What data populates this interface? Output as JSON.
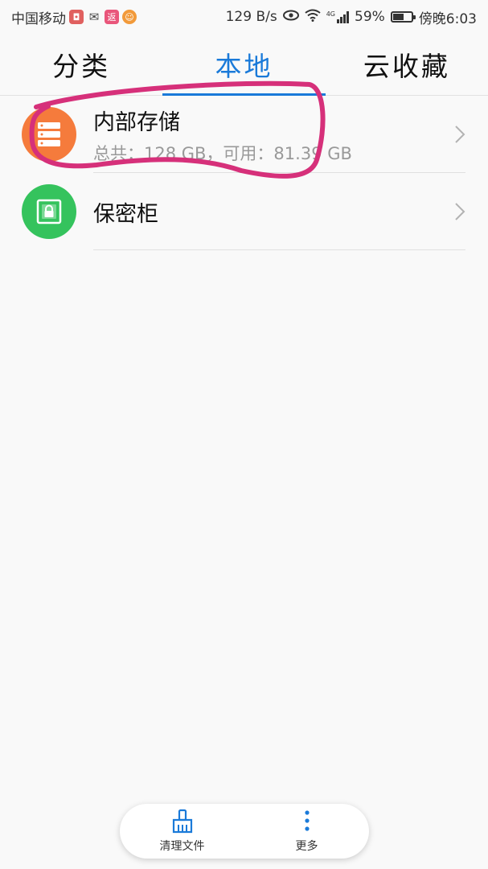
{
  "status_bar": {
    "carrier": "中国移动",
    "app_icons": [
      {
        "name": "red-app-icon",
        "color": "#e0605f",
        "glyph": "◘"
      },
      {
        "name": "wechat-icon",
        "color": "#444444",
        "glyph": "✉"
      },
      {
        "name": "fanli-icon",
        "color": "#e9567b",
        "glyph": "返"
      },
      {
        "name": "tmall-icon",
        "color": "#f29a3a",
        "glyph": "☺"
      }
    ],
    "net_speed": "129 B/s",
    "network_type": "4G",
    "battery_percent": "59%",
    "battery_level": 0.59,
    "time": "傍晚6:03"
  },
  "tabs": [
    {
      "label": "分类",
      "active": false
    },
    {
      "label": "本地",
      "active": true
    },
    {
      "label": "云收藏",
      "active": false
    }
  ],
  "storage_list": [
    {
      "title": "内部存储",
      "subtitle": "总共：128 GB，可用：81.39 GB",
      "icon": "storage-stack-icon",
      "icon_color": "#f57b3c"
    },
    {
      "title": "保密柜",
      "icon": "safe-lock-icon",
      "icon_color": "#35c35d"
    }
  ],
  "bottom_bar": {
    "clean_label": "清理文件",
    "more_label": "更多",
    "accent": "#1a7ad9"
  },
  "annotation_color": "#d6307a"
}
